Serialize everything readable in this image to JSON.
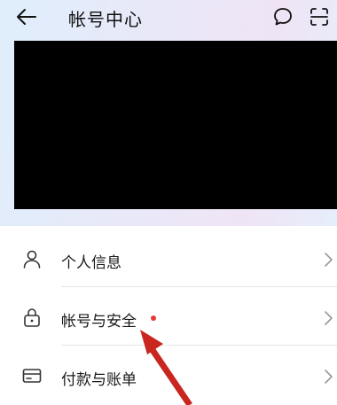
{
  "header": {
    "title": "帐号中心",
    "back_icon": "arrow-left-icon",
    "chat_icon": "chat-bubble-icon",
    "scan_icon": "scan-icon"
  },
  "menu": {
    "items": [
      {
        "label": "个人信息",
        "icon": "person-icon",
        "badge": false
      },
      {
        "label": "帐号与安全",
        "icon": "lock-icon",
        "badge": true
      },
      {
        "label": "付款与账单",
        "icon": "card-icon",
        "badge": false
      }
    ]
  },
  "colors": {
    "badge": "#e53935",
    "annotation_arrow": "#c8261e"
  }
}
